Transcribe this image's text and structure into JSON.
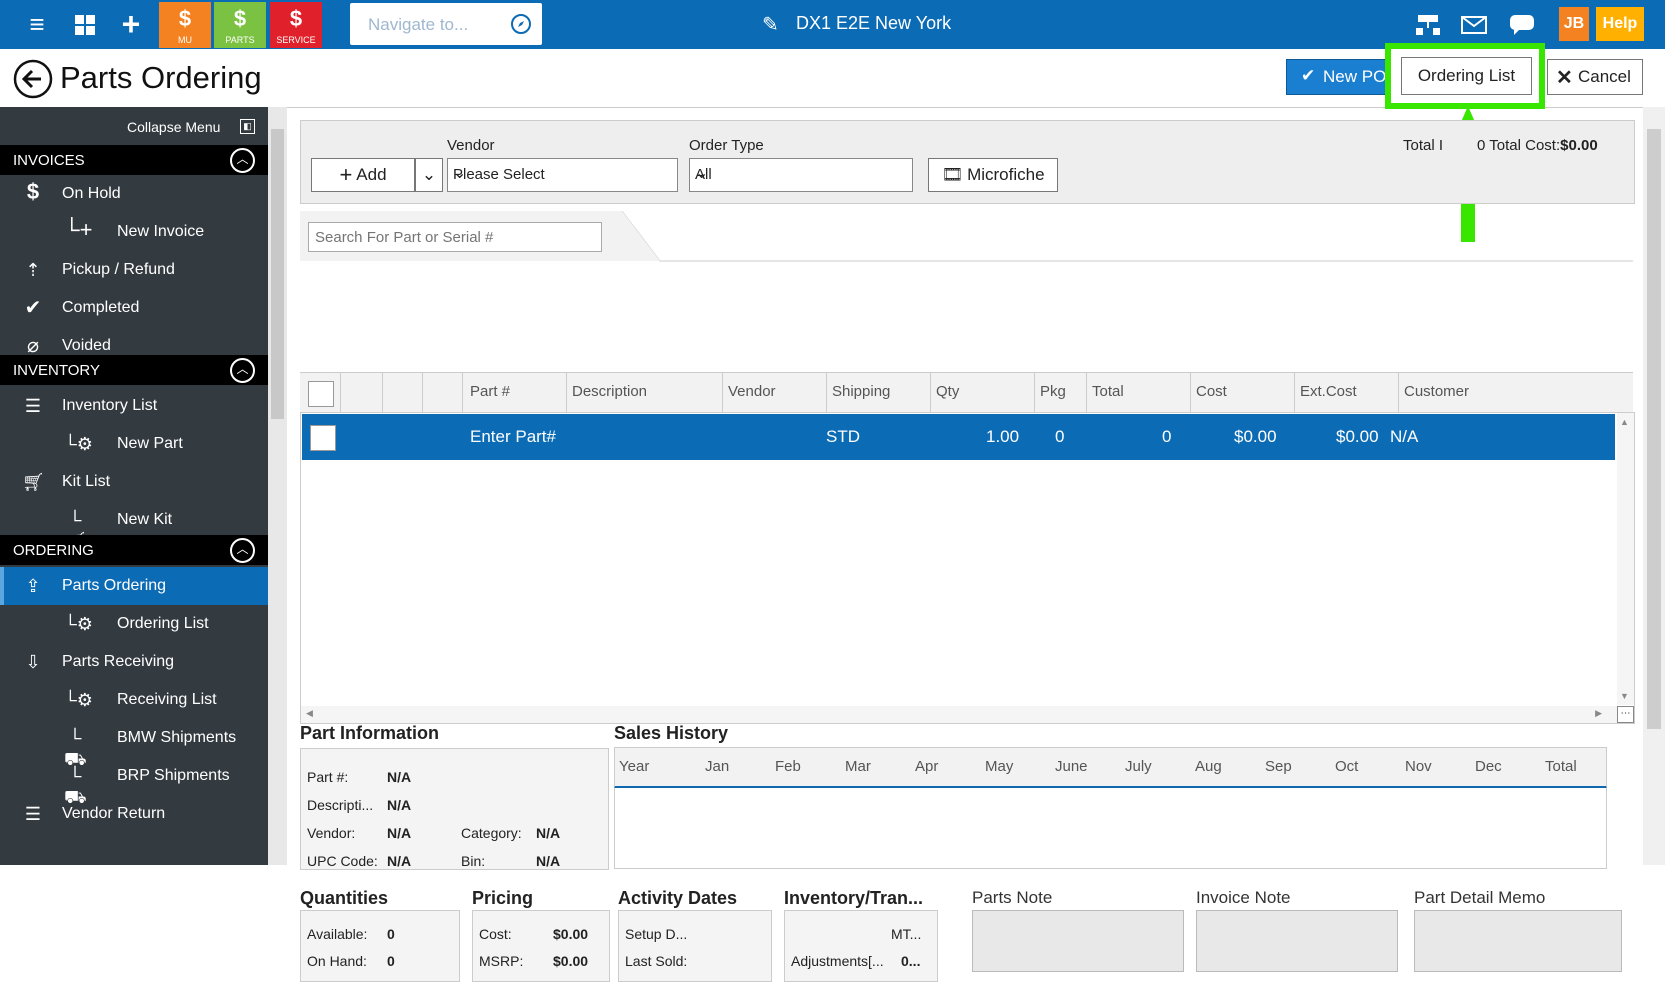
{
  "topbar": {
    "tiles": [
      {
        "label": "MU",
        "color": "#f58220"
      },
      {
        "label": "PARTS",
        "color": "#7cc242"
      },
      {
        "label": "SERVICE",
        "color": "#e0202a"
      }
    ],
    "navigate_placeholder": "Navigate to...",
    "store_name": "DX1 E2E New York",
    "user_initials": "JB",
    "help_label": "Help"
  },
  "header": {
    "page_title": "Parts Ordering",
    "new_po_label": "New PO",
    "ordering_list_label": "Ordering List",
    "cancel_label": "Cancel"
  },
  "sidebar": {
    "collapse_label": "Collapse Menu",
    "sections": [
      {
        "title": "INVOICES",
        "items": [
          {
            "label": "On Hold",
            "icon": "dollar-icon",
            "sub": false
          },
          {
            "label": "New Invoice",
            "icon": "plus-icon",
            "sub": true
          },
          {
            "label": "Pickup / Refund",
            "icon": "refund-icon",
            "sub": false
          },
          {
            "label": "Completed",
            "icon": "check-icon",
            "sub": false
          },
          {
            "label": "Voided",
            "icon": "void-icon",
            "sub": false
          }
        ]
      },
      {
        "title": "INVENTORY",
        "items": [
          {
            "label": "Inventory List",
            "icon": "list-icon",
            "sub": false
          },
          {
            "label": "New Part",
            "icon": "gears-icon",
            "sub": true
          },
          {
            "label": "Kit List",
            "icon": "cart-icon",
            "sub": false
          },
          {
            "label": "New Kit",
            "icon": "cart-icon",
            "sub": true
          }
        ]
      },
      {
        "title": "ORDERING",
        "items": [
          {
            "label": "Parts Ordering",
            "icon": "export-icon",
            "sub": false,
            "active": true
          },
          {
            "label": "Ordering List",
            "icon": "gears-icon",
            "sub": true
          },
          {
            "label": "Parts Receiving",
            "icon": "receive-icon",
            "sub": false
          },
          {
            "label": "Receiving List",
            "icon": "gears-icon",
            "sub": true
          },
          {
            "label": "BMW Shipments",
            "icon": "truck-icon",
            "sub": true
          },
          {
            "label": "BRP Shipments",
            "icon": "truck-icon",
            "sub": true
          },
          {
            "label": "Vendor Return",
            "icon": "list-icon",
            "sub": false
          }
        ]
      }
    ]
  },
  "toolbar": {
    "add_label": "Add",
    "vendor_label": "Vendor",
    "vendor_value": "Please Select",
    "order_type_label": "Order Type",
    "order_type_value": "All",
    "microfiche_label": "Microfiche",
    "totals_text": "Total I",
    "totals_text2": "0 Total Cost:",
    "total_cost": "$0.00"
  },
  "search": {
    "placeholder": "Search For Part or Serial #"
  },
  "grid": {
    "columns": [
      "Part #",
      "Description",
      "Vendor",
      "Shipping",
      "Qty",
      "Pkg",
      "Total",
      "Cost",
      "Ext.Cost",
      "Customer"
    ],
    "row": {
      "part": "Enter Part#",
      "shipping": "STD",
      "qty": "1.00",
      "pkg": "0",
      "total": "0",
      "cost": "$0.00",
      "ext_cost": "$0.00",
      "customer": "N/A"
    }
  },
  "part_info": {
    "title": "Part Information",
    "part_label": "Part #:",
    "part_value": "N/A",
    "desc_label": "Descripti...",
    "desc_value": "N/A",
    "vendor_label": "Vendor:",
    "vendor_value": "N/A",
    "category_label": "Category:",
    "category_value": "N/A",
    "upc_label": "UPC Code:",
    "upc_value": "N/A",
    "bin_label": "Bin:",
    "bin_value": "N/A"
  },
  "sales_history": {
    "title": "Sales History",
    "months": [
      "Year",
      "Jan",
      "Feb",
      "Mar",
      "Apr",
      "May",
      "June",
      "July",
      "Aug",
      "Sep",
      "Oct",
      "Nov",
      "Dec",
      "Total"
    ]
  },
  "quantities": {
    "title": "Quantities",
    "available_label": "Available:",
    "available_value": "0",
    "onhand_label": "On Hand:",
    "onhand_value": "0"
  },
  "pricing": {
    "title": "Pricing",
    "cost_label": "Cost:",
    "cost_value": "$0.00",
    "msrp_label": "MSRP:",
    "msrp_value": "$0.00"
  },
  "activity": {
    "title": "Activity Dates",
    "setup_label": "Setup D...",
    "last_sold_label": "Last Sold:"
  },
  "inventory_tran": {
    "title": "Inventory/Tran...",
    "mt_label": "MT...",
    "adj_label": "Adjustments[...",
    "adj_value": "0..."
  },
  "notes": {
    "parts_note": "Parts Note",
    "invoice_note": "Invoice Note",
    "part_detail_memo": "Part Detail Memo"
  },
  "highlight_color": "#39e600"
}
